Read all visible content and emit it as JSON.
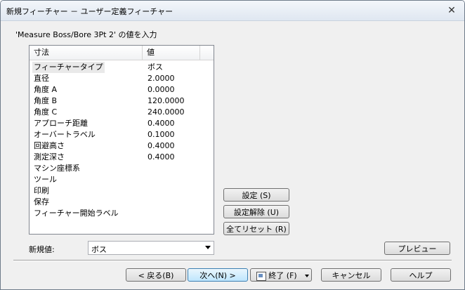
{
  "window": {
    "title": "新規フィーチャー － ユーザー定義フィーチャー",
    "prompt": "'Measure Boss/Bore 3Pt 2' の値を入力"
  },
  "table": {
    "headers": [
      "寸法",
      "値"
    ],
    "rows": [
      {
        "name": "フィーチャータイプ",
        "value": "ボス"
      },
      {
        "name": "直径",
        "value": "2.0000"
      },
      {
        "name": "角度 A",
        "value": "0.0000"
      },
      {
        "name": "角度 B",
        "value": "120.0000"
      },
      {
        "name": "角度 C",
        "value": "240.0000"
      },
      {
        "name": "アプローチ距離",
        "value": "0.4000"
      },
      {
        "name": "オーバートラベル",
        "value": "0.1000"
      },
      {
        "name": "回避高さ",
        "value": "0.4000"
      },
      {
        "name": "測定深さ",
        "value": "0.4000"
      },
      {
        "name": "マシン座標系",
        "value": ""
      },
      {
        "name": "ツール",
        "value": ""
      },
      {
        "name": "印刷",
        "value": ""
      },
      {
        "name": "保存",
        "value": ""
      },
      {
        "name": "フィーチャー開始ラベル",
        "value": ""
      }
    ]
  },
  "side_buttons": {
    "set": "設定 (S)",
    "unset": "設定解除 (U)",
    "reset_all": "全てリセット (R)",
    "preview": "プレビュー"
  },
  "new_value": {
    "label": "新規値:",
    "selected": "ボス"
  },
  "footer": {
    "back": "< 戻る(B)",
    "next": "次へ(N) >",
    "finish": "終了 (F)",
    "cancel": "キャンセル",
    "help": "ヘルプ"
  }
}
